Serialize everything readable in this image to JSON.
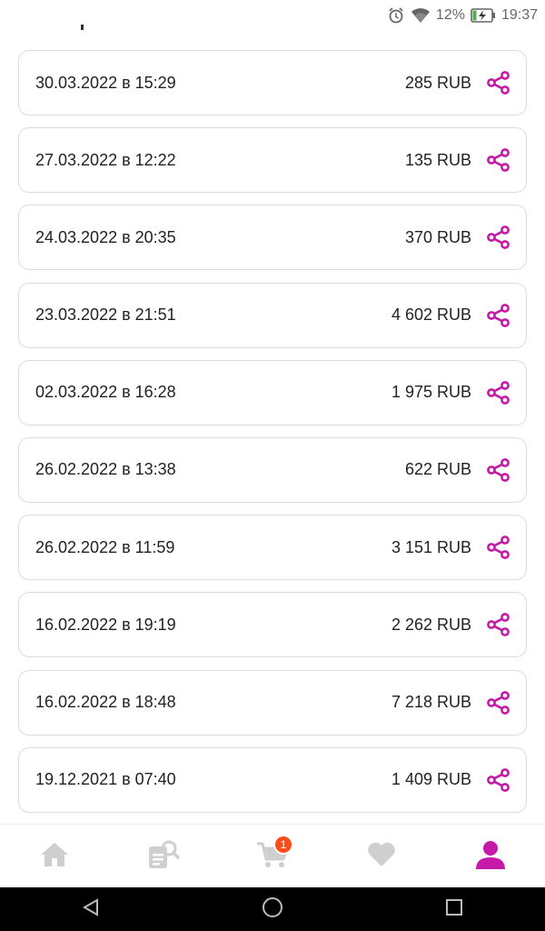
{
  "status_bar": {
    "battery_percent": "12%",
    "time": "19:37",
    "icons": [
      "alarm-icon",
      "wifi-icon",
      "battery-charging-icon"
    ]
  },
  "orders": [
    {
      "date": "30.03.2022 в 15:29",
      "amount": "285 RUB"
    },
    {
      "date": "27.03.2022 в 12:22",
      "amount": "135 RUB"
    },
    {
      "date": "24.03.2022 в 20:35",
      "amount": "370 RUB"
    },
    {
      "date": "23.03.2022 в 21:51",
      "amount": "4 602 RUB"
    },
    {
      "date": "02.03.2022 в 16:28",
      "amount": "1 975 RUB"
    },
    {
      "date": "26.02.2022 в 13:38",
      "amount": "622 RUB"
    },
    {
      "date": "26.02.2022 в 11:59",
      "amount": "3 151 RUB"
    },
    {
      "date": "16.02.2022 в 19:19",
      "amount": "2 262 RUB"
    },
    {
      "date": "16.02.2022 в 18:48",
      "amount": "7 218 RUB"
    },
    {
      "date": "19.12.2021 в 07:40",
      "amount": "1 409 RUB"
    }
  ],
  "bottom_nav": {
    "items": [
      "home-icon",
      "catalog-search-icon",
      "cart-icon",
      "favorites-icon",
      "profile-icon"
    ],
    "active": "profile-icon",
    "cart_badge": "1"
  },
  "colors": {
    "accent": "#c51aa8",
    "inactive_icon": "#cfcfcf",
    "badge": "#ff4d1a"
  }
}
